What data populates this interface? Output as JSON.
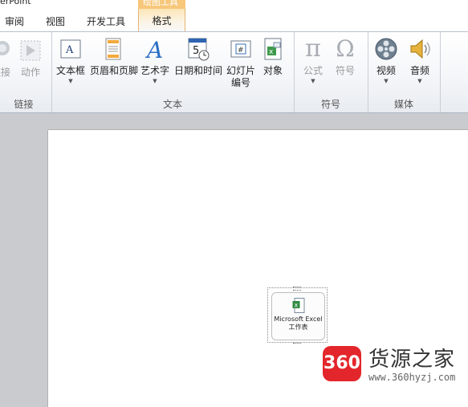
{
  "window": {
    "app_title_fragment": "erPoint",
    "context_tab_title": "绘图工具"
  },
  "tabs": [
    {
      "label": "审阅"
    },
    {
      "label": "视图"
    },
    {
      "label": "开发工具"
    },
    {
      "label": "格式"
    }
  ],
  "ribbon": {
    "groups": {
      "links": {
        "label": "链接",
        "commands": {
          "hyperlink": "链接",
          "action": "动作"
        }
      },
      "text": {
        "label": "文本",
        "commands": {
          "textbox": "文本框",
          "header_footer": "页眉和页脚",
          "wordart": "艺术字",
          "datetime": "日期和时间",
          "slide_number_line1": "幻灯片",
          "slide_number_line2": "编号",
          "object": "对象"
        }
      },
      "symbols": {
        "label": "符号",
        "commands": {
          "equation": "公式",
          "symbol": "符号"
        }
      },
      "media": {
        "label": "媒体",
        "commands": {
          "video": "视频",
          "audio": "音频"
        }
      }
    }
  },
  "slide": {
    "embedded_object": {
      "line1": "Microsoft Excel",
      "line2": "工作表"
    }
  },
  "watermark": {
    "badge": "360",
    "name": "货源之家",
    "url": "www.360hyzj.com"
  },
  "icons": {
    "textbox": "textbox-icon",
    "header_footer": "header-footer-icon",
    "wordart": "wordart-a-icon",
    "datetime": "calendar-clock-icon",
    "slide_number": "slide-number-icon",
    "object": "insert-object-icon",
    "equation": "pi-icon",
    "symbol": "omega-icon",
    "video": "film-reel-icon",
    "audio": "speaker-icon",
    "excel": "excel-file-icon"
  },
  "colors": {
    "context_tab": "#f7c77a",
    "watermark_red": "#e3262b"
  }
}
